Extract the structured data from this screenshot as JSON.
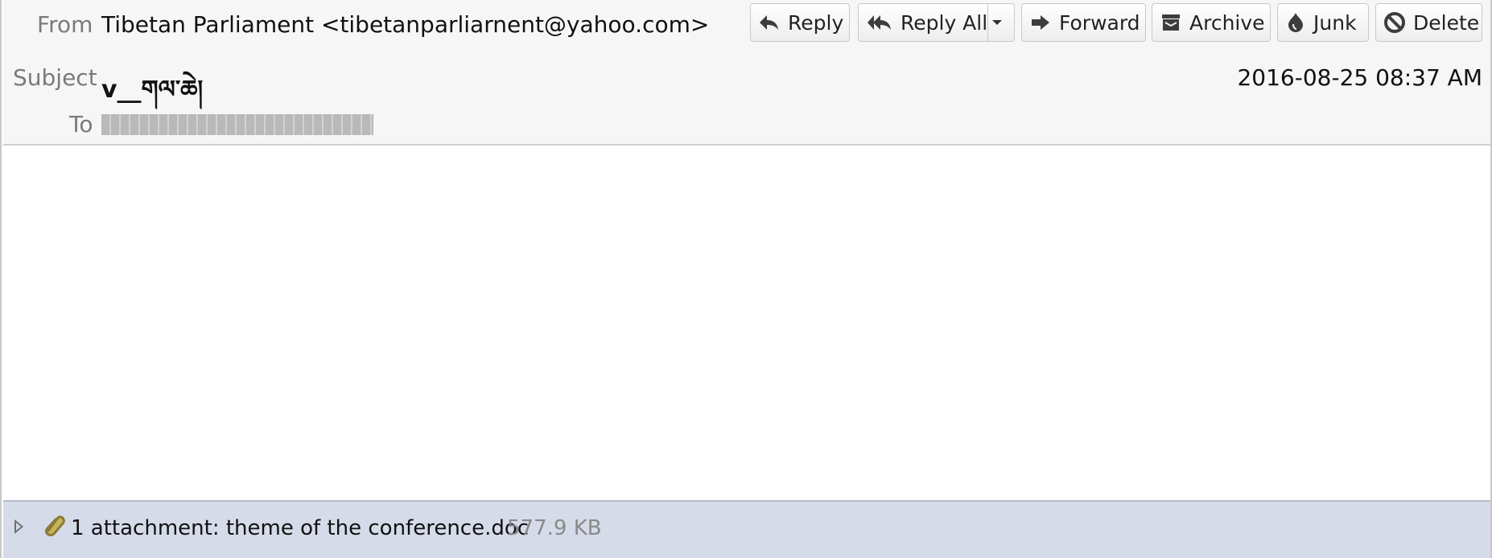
{
  "header": {
    "from_label": "From",
    "from_value": "Tibetan Parliament <tibetanparliarnent@yahoo.com>",
    "subject_label": "Subject",
    "subject_value": "v__གལ་ཆེ།",
    "to_label": "To",
    "date": "2016-08-25 08:37 AM"
  },
  "toolbar": {
    "reply": "Reply",
    "reply_all": "Reply All",
    "forward": "Forward",
    "archive": "Archive",
    "junk": "Junk",
    "delete": "Delete"
  },
  "attachment": {
    "summary": "1 attachment: theme of the conference.doc",
    "size": "577.9 KB"
  },
  "icons": {
    "reply": "reply-icon",
    "reply_all": "reply-all-icon",
    "dropdown": "chevron-down-icon",
    "forward": "forward-icon",
    "archive": "archive-icon",
    "junk": "junk-icon",
    "delete": "delete-icon",
    "attachment": "paperclip-icon",
    "toggle": "expand-triangle-icon"
  }
}
